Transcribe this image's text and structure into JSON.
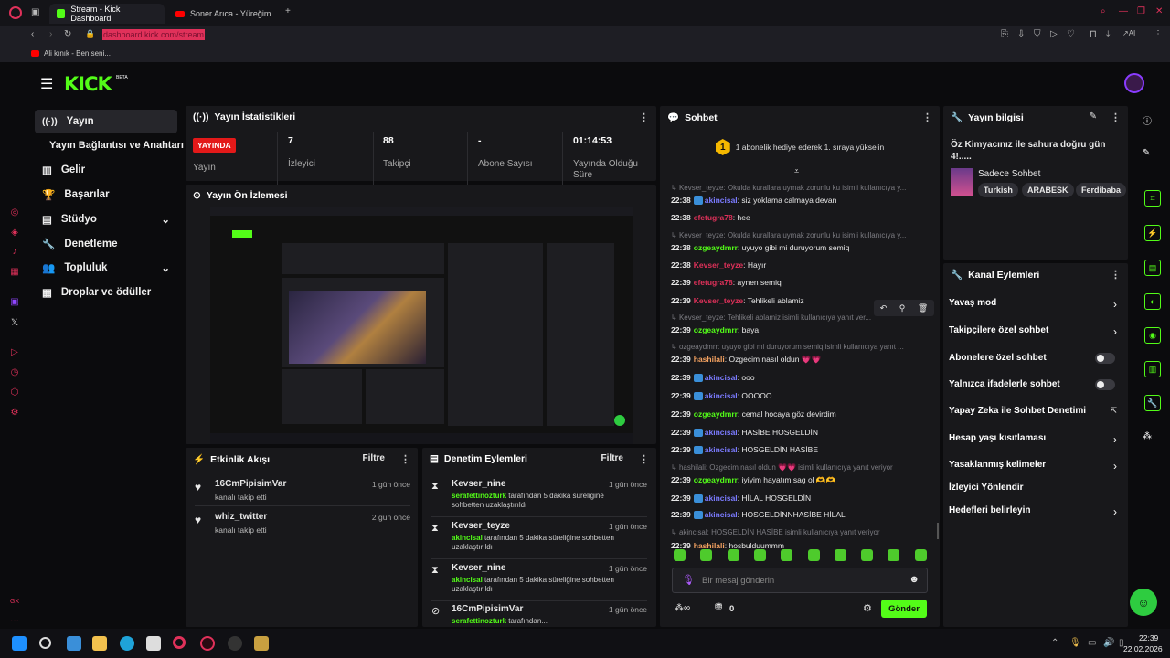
{
  "browser": {
    "tabs": [
      {
        "label": "Stream - Kick Dashboard"
      },
      {
        "label": "Soner Arıca - Yüreğim"
      }
    ],
    "url": "dashboard.kick.com/stream",
    "bookmark": "Ali kınık - Ben seni..."
  },
  "brand": {
    "logo": "KICK",
    "beta": "BETA",
    "accent": "#53fc18"
  },
  "nav": {
    "items": [
      {
        "label": "Yayın",
        "icon": "broadcast-icon"
      },
      {
        "label": "Yayın Bağlantısı ve Anahtarı",
        "icon": ""
      },
      {
        "label": "Gelir",
        "icon": "chart-icon"
      },
      {
        "label": "Başarılar",
        "icon": "trophy-icon"
      },
      {
        "label": "Stüdyo",
        "icon": "studio-icon"
      },
      {
        "label": "Denetleme",
        "icon": "wrench-icon"
      },
      {
        "label": "Topluluk",
        "icon": "users-icon"
      },
      {
        "label": "Droplar ve ödüller",
        "icon": "gift-icon"
      }
    ]
  },
  "stats": {
    "title": "Yayın İstatistikleri",
    "live_badge": "YAYINDA",
    "items": [
      {
        "value": "",
        "label": "Yayın"
      },
      {
        "value": "7",
        "label": "İzleyici"
      },
      {
        "value": "88",
        "label": "Takipçi"
      },
      {
        "value": "-",
        "label": "Abone Sayısı"
      },
      {
        "value": "01:14:53",
        "label": "Yayında Olduğu Süre"
      }
    ]
  },
  "preview": {
    "title": "Yayın Ön İzlemesi"
  },
  "activity": {
    "title": "Etkinlik Akışı",
    "filter": "Filtre",
    "items": [
      {
        "user": "16CmPipisimVar",
        "action": "kanalı takip etti",
        "time": "1 gün önce"
      },
      {
        "user": "whiz_twitter",
        "action": "kanalı takip etti",
        "time": "2 gün önce"
      }
    ]
  },
  "moderation": {
    "title": "Denetim Eylemleri",
    "filter": "Filtre",
    "items": [
      {
        "user": "Kevser_nine",
        "mod": "serafettinozturk",
        "text": "tarafından 5 dakika süreliğine",
        "text2": "sohbetten uzaklaştırıldı",
        "time": "1 gün önce"
      },
      {
        "user": "Kevser_teyze",
        "mod": "akincisal",
        "text": "tarafından 5 dakika süreliğine sohbetten",
        "text2": "uzaklaştırıldı",
        "time": "1 gün önce"
      },
      {
        "user": "Kevser_nine",
        "mod": "akincisal",
        "text": "tarafından 5 dakika süreliğine sohbetten",
        "text2": "uzaklaştırıldı",
        "time": "1 gün önce"
      },
      {
        "user": "16CmPipisimVar",
        "mod": "serafettinozturk",
        "text": "tarafından...",
        "text2": "",
        "time": "1 gün önce"
      }
    ]
  },
  "chat": {
    "title": "Sohbet",
    "pinned": "1 abonelik hediye ederek 1. sıraya yükselin",
    "pinned_num": "1",
    "input_placeholder": "Bir mesaj gönderin",
    "send": "Gönder",
    "points": "0",
    "lines": [
      {
        "reply": "Kevser_teyze: Okulda kurallara uymak zorunlu ku isimli kullanıcıya y..."
      },
      {
        "time": "22:38",
        "user": "akincisal",
        "color": "#7b7bff",
        "badge": true,
        "msg": "siz yoklama calmaya devan"
      },
      {
        "time": "22:38",
        "user": "efetugra78",
        "color": "#e0315a",
        "badge": false,
        "msg": "hee"
      },
      {
        "reply": "Kevser_teyze: Okulda kurallara uymak zorunlu ku isimli kullanıcıya y..."
      },
      {
        "time": "22:38",
        "user": "ozgeaydmrr",
        "color": "#53fc18",
        "badge": false,
        "msg": "uyuyo gibi mi duruyorum semiq"
      },
      {
        "time": "22:38",
        "user": "Kevser_teyze",
        "color": "#e0315a",
        "badge": false,
        "msg": "Hayır"
      },
      {
        "time": "22:39",
        "user": "efetugra78",
        "color": "#e0315a",
        "badge": false,
        "msg": "aynen semiq"
      },
      {
        "time": "22:39",
        "user": "Kevser_teyze",
        "color": "#e0315a",
        "badge": false,
        "msg": "Tehlikeli ablamiz"
      },
      {
        "reply": "Kevser_teyze: Tehlikeli ablamiz isimli kullanıcıya yanıt ver..."
      },
      {
        "time": "22:39",
        "user": "ozgeaydmrr",
        "color": "#53fc18",
        "badge": false,
        "msg": "baya"
      },
      {
        "reply": "ozgeaydmrr: uyuyo gibi mi duruyorum semiq isimli kullanıcıya yanıt ..."
      },
      {
        "time": "22:39",
        "user": "hashilali",
        "color": "#f4a261",
        "badge": false,
        "msg": "Ozgecim nasıl oldun 💗💗"
      },
      {
        "time": "22:39",
        "user": "akincisal",
        "color": "#7b7bff",
        "badge": true,
        "msg": "ooo"
      },
      {
        "time": "22:39",
        "user": "akincisal",
        "color": "#7b7bff",
        "badge": true,
        "msg": "OOOOO"
      },
      {
        "time": "22:39",
        "user": "ozgeaydmrr",
        "color": "#53fc18",
        "badge": false,
        "msg": "cemal hocaya göz devirdim"
      },
      {
        "time": "22:39",
        "user": "akincisal",
        "color": "#7b7bff",
        "badge": true,
        "msg": "HASİBE HOSGELDİN"
      },
      {
        "time": "22:39",
        "user": "akincisal",
        "color": "#7b7bff",
        "badge": true,
        "msg": "HOSGELDİN HASİBE"
      },
      {
        "reply": "hashilali: Ozgecim nasıl oldun 💗💗 isimli kullanıcıya yanıt veriyor"
      },
      {
        "time": "22:39",
        "user": "ozgeaydmrr",
        "color": "#53fc18",
        "badge": false,
        "msg": "iyiyim hayatım sag ol 🫶🫶"
      },
      {
        "time": "22:39",
        "user": "akincisal",
        "color": "#7b7bff",
        "badge": true,
        "msg": "HİLAL HOSGELDİN"
      },
      {
        "time": "22:39",
        "user": "akincisal",
        "color": "#7b7bff",
        "badge": true,
        "msg": "HOSGELDİNNHASİBE HİLAL"
      },
      {
        "reply": "akincisal: HOSGELDİN HASİBE isimli kullanıcıya yanıt veriyor"
      },
      {
        "time": "22:39",
        "user": "hashilali",
        "color": "#f4a261",
        "badge": false,
        "msg": "hosbulduummm"
      }
    ]
  },
  "stream_info": {
    "title": "Yayın bilgisi",
    "stream_title": "Öz Kimyacınız ile sahura doğru gün 4!.....",
    "category": "Sadece Sohbet",
    "tags": [
      "Turkish",
      "ARABESK",
      "Ferdibaba"
    ]
  },
  "channel_actions": {
    "title": "Kanal Eylemleri",
    "items": [
      {
        "label": "Yavaş mod",
        "control": "chevron"
      },
      {
        "label": "Takipçilere özel sohbet",
        "control": "chevron"
      },
      {
        "label": "Abonelere özel sohbet",
        "control": "toggle"
      },
      {
        "label": "Yalnızca ifadelerle sohbet",
        "control": "toggle"
      },
      {
        "label": "Yapay Zeka ile Sohbet Denetimi",
        "control": "external"
      },
      {
        "label": "Hesap yaşı kısıtlaması",
        "control": "chevron"
      },
      {
        "label": "Yasaklanmış kelimeler",
        "control": "chevron"
      },
      {
        "label": "İzleyici Yönlendir",
        "control": "none"
      },
      {
        "label": "Hedefleri belirleyin",
        "control": "chevron"
      }
    ]
  },
  "taskbar": {
    "time": "22:39",
    "date": "22.02.2026"
  }
}
